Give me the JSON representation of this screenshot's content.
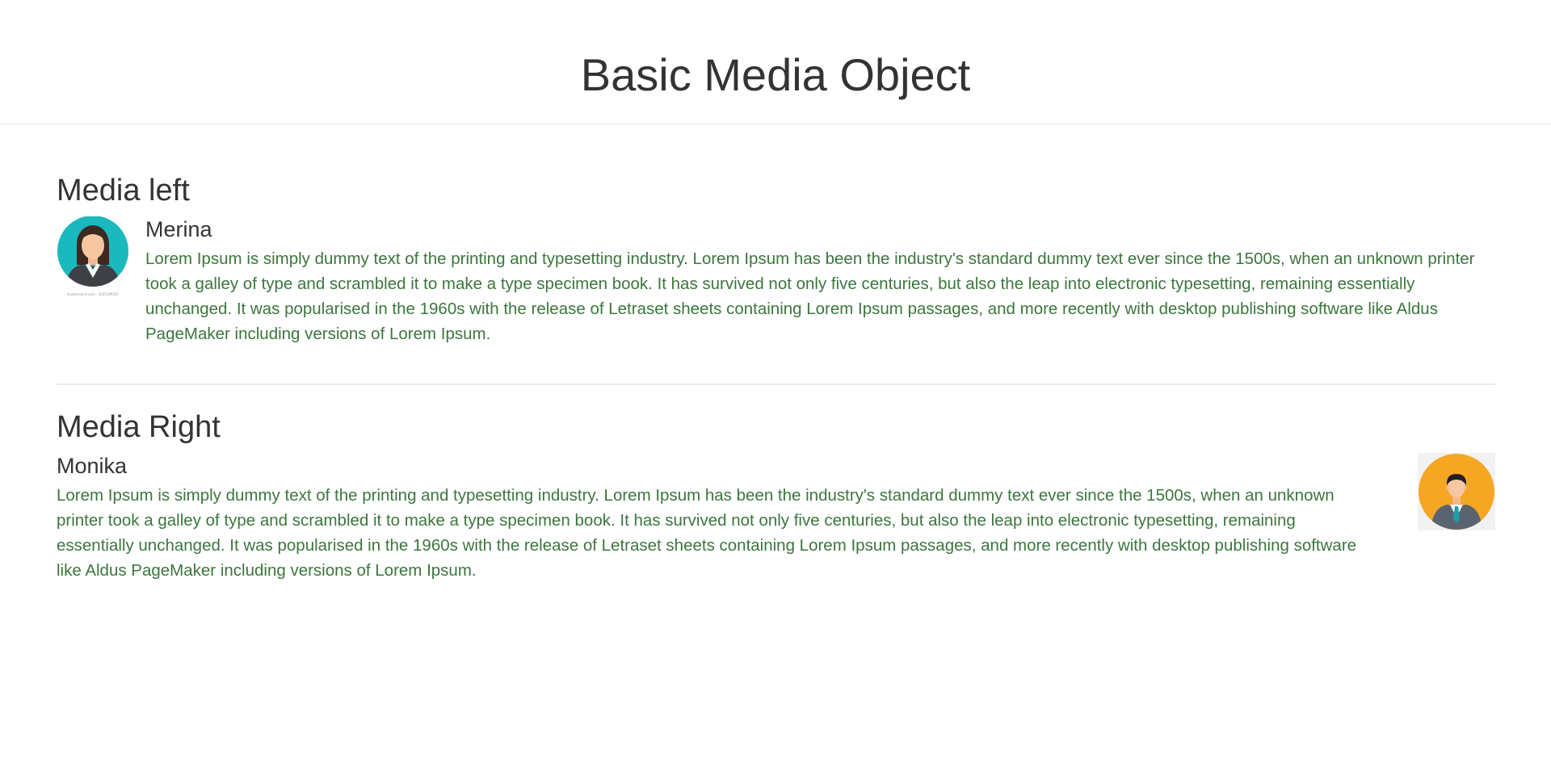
{
  "header": {
    "title": "Basic Media Object"
  },
  "section_left": {
    "heading": "Media left",
    "name": "Merina",
    "text": "Lorem Ipsum is simply dummy text of the printing and typesetting industry. Lorem Ipsum has been the industry's standard dummy text ever since the 1500s, when an unknown printer took a galley of type and scrambled it to make a type specimen book. It has survived not only five centuries, but also the leap into electronic typesetting, remaining essentially unchanged. It was popularised in the 1960s with the release of Letraset sheets containing Lorem Ipsum passages, and more recently with desktop publishing software like Aldus PageMaker including versions of Lorem Ipsum.",
    "avatar_icon": "female-avatar-icon",
    "avatar_bg": "#1bb9bd"
  },
  "section_right": {
    "heading": "Media Right",
    "name": "Monika",
    "text": "Lorem Ipsum is simply dummy text of the printing and typesetting industry. Lorem Ipsum has been the industry's standard dummy text ever since the 1500s, when an unknown printer took a galley of type and scrambled it to make a type specimen book. It has survived not only five centuries, but also the leap into electronic typesetting, remaining essentially unchanged. It was popularised in the 1960s with the release of Letraset sheets containing Lorem Ipsum passages, and more recently with desktop publishing software like Aldus PageMaker including versions of Lorem Ipsum.",
    "avatar_icon": "male-avatar-icon",
    "avatar_bg": "#f5a623"
  },
  "colors": {
    "body_text": "#3c763d",
    "heading": "#333333",
    "divider": "#e5e5e5"
  }
}
